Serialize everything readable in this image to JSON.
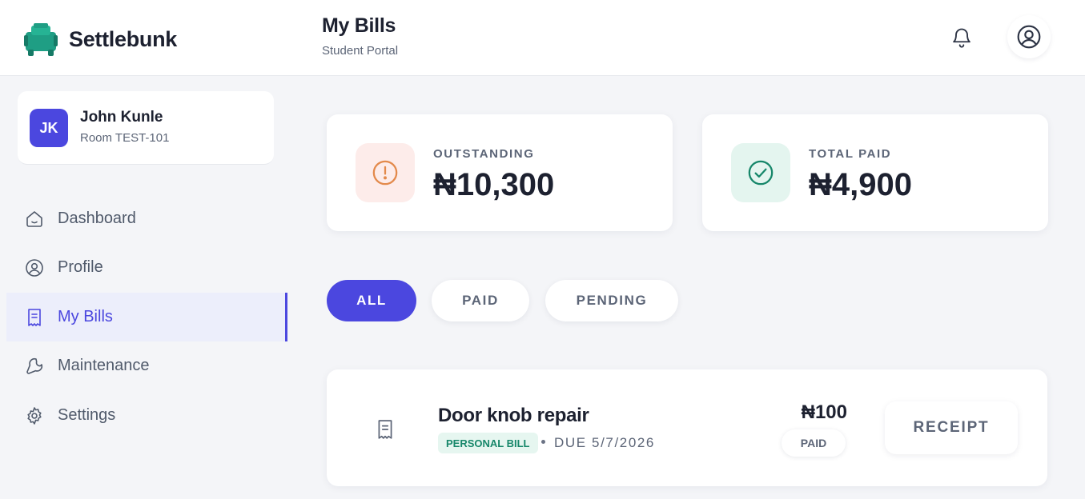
{
  "app": {
    "brand_name": "Settlebunk",
    "page_title": "My Bills",
    "page_subtitle": "Student Portal"
  },
  "user": {
    "initials": "JK",
    "name": "John Kunle",
    "room": "Room TEST-101"
  },
  "nav": {
    "items": [
      {
        "label": "Dashboard",
        "icon": "home-icon",
        "active": false
      },
      {
        "label": "Profile",
        "icon": "user-circle-icon",
        "active": false
      },
      {
        "label": "My Bills",
        "icon": "receipt-icon",
        "active": true
      },
      {
        "label": "Maintenance",
        "icon": "wrench-icon",
        "active": false
      },
      {
        "label": "Settings",
        "icon": "gear-icon",
        "active": false
      }
    ]
  },
  "summary": {
    "outstanding": {
      "label": "OUTSTANDING",
      "value": "₦10,300",
      "icon": "alert-circle-icon"
    },
    "total_paid": {
      "label": "TOTAL PAID",
      "value": "₦4,900",
      "icon": "check-circle-icon"
    }
  },
  "filters": {
    "all": "ALL",
    "paid": "PAID",
    "pending": "PENDING",
    "selected": "ALL"
  },
  "bills": [
    {
      "title": "Door knob repair",
      "tag": "PERSONAL BILL",
      "due": "DUE 5/7/2026",
      "amount": "₦100",
      "status": "PAID",
      "action": "RECEIPT",
      "icon": "receipt-icon"
    }
  ],
  "colors": {
    "accent": "#4b47df",
    "brand_green": "#1f9e84",
    "outstanding": "#e38a4c",
    "paid": "#17876a"
  }
}
